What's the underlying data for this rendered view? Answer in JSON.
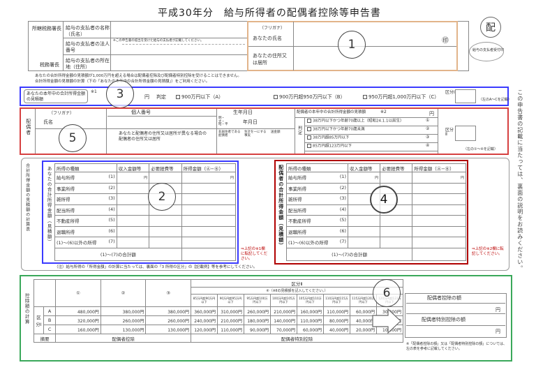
{
  "title": "平成30年分　給与所得者の配偶者控除等申告書",
  "stamp": "配",
  "stamp_sub": "給与の支払者受付印",
  "side_note": "この申告書の記載に当たっては、裏面の説明をお読みください。",
  "header": {
    "office": "所轄税務署長",
    "tax_office": "税務署長",
    "payer_name": "給与の支払者の名称（氏名）",
    "payer_number": "給与の支払者の法人番号",
    "number_note": "※この申告書の提出を受けた給与の支払者が記載してください。",
    "payer_address": "給与の支払者の所在地（住所）",
    "furigana": "（フリガナ）",
    "your_name": "あなたの氏名",
    "seal": "㊞",
    "your_address": "あなたの住所又は居所"
  },
  "notes": [
    "あなたの合計所得金額の見積額が1,000万円を超える場合は配偶者控除及び配偶者特別控除を受けることはできません。",
    "合計所得金額の見積額の計算（下の「あなたの本年中の合計所得金額の見積額」）をご利用ください。"
  ],
  "sec3": {
    "label": "あなたの本年中の合計所得金額の見積額",
    "mark": "※1",
    "yen": "円",
    "judge": "判定",
    "options": [
      "900万円以下（A）",
      "900万円超950万円以下（B）",
      "950万円超1,000万円以下（C）"
    ],
    "kubun": "区分Ⅰ",
    "kubun_note": "（左のA〜Cを記載）"
  },
  "sec5": {
    "spouse": "配偶者",
    "furigana": "（フリガナ）",
    "name": "氏名",
    "mynumber": "個人番号",
    "birth": "生年月日",
    "era": "明・大・昭・平",
    "ymd": "年月日",
    "diff_addr": "あなたと配偶者の住所又は居所が異なる場合の配偶者の住所又は居所",
    "col1": "非居住者である配偶者",
    "col2": "生計を一にする事実",
    "col3": "送金額",
    "income_hdr": "配偶者の本年中の合計所得金額の見積額",
    "mark": "※2",
    "yen": "円",
    "judge": "判定",
    "conds": [
      "38万円以下かつ年齢70歳以上（昭和24.1.1以前生）",
      "38万円以下かつ年齢70歳未満",
      "38万円超85万円以下",
      "85万円超123万円以下"
    ],
    "cond_nums": [
      "①",
      "②",
      "③",
      "④"
    ],
    "kubun": "区分Ⅱ",
    "kubun_note": "（左の①〜④を記載）"
  },
  "sec2": {
    "vlabel": "あなたの合計所得金額（見積額）",
    "headers": [
      "所得の種類",
      "収入金額等",
      "必要経費等",
      "所得金額（Ⓐ−Ⓑ）"
    ],
    "rows": [
      "給与所得",
      "事業所得",
      "雑所得",
      "配当所得",
      "不動産所得",
      "退職所得",
      "(1)〜(6)以外の所得"
    ],
    "nums": [
      "(1)",
      "(2)",
      "(3)",
      "(4)",
      "(5)",
      "(6)",
      "(7)"
    ],
    "total": "(1)〜(7)の合計額",
    "arrow_note": "⇒上記の※1欄に転記してください。",
    "yen": "円"
  },
  "sec4": {
    "vlabel": "配偶者の合計所得金額（見積額）",
    "headers": [
      "所得の種類",
      "収入金額等",
      "必要経費等",
      "所得金額（Ⓐ−Ⓑ）"
    ],
    "rows": [
      "給与所得",
      "事業所得",
      "雑所得",
      "配当所得",
      "不動産所得",
      "退職所得",
      "(1)〜(6)以外の所得"
    ],
    "nums": [
      "(1)",
      "(2)",
      "(3)",
      "(4)",
      "(5)",
      "(6)",
      "(7)"
    ],
    "total": "(1)〜(7)の合計額",
    "arrow_note": "⇒上記の※2欄に転記してください。",
    "yen": "円"
  },
  "calc_side": "合計所得金額の見積額の計算表",
  "footnote": "（注）給与所得の「所得金額」の計算に当たっては、裏面の「3 所得の区分」の【記載例】等を参考にしてください。",
  "sec6": {
    "side": "控除額の計算",
    "kubun2": "区分Ⅱ",
    "kubun1": "区分Ⅰ",
    "note": "④（※Ⅱの見積額を記入してください。）",
    "cols": [
      "①",
      "②",
      "③"
    ],
    "subcols": [
      "85万円超90万円以下",
      "90万円超95万円以下",
      "95万円超100万円以下",
      "100万円超105万円以下",
      "105万円超110万円以下",
      "110万円超115万円以下",
      "115万円超120万円以下",
      "120万円超123万円以下"
    ],
    "rows": [
      {
        "k": "A",
        "v": [
          "480,000円",
          "380,000円",
          "380,000円",
          "360,000円",
          "310,000円",
          "260,000円",
          "210,000円",
          "160,000円",
          "110,000円",
          "60,000円",
          "30,000円"
        ]
      },
      {
        "k": "B",
        "v": [
          "320,000円",
          "260,000円",
          "260,000円",
          "240,000円",
          "210,000円",
          "180,000円",
          "140,000円",
          "110,000円",
          "80,000円",
          "40,000円",
          "20,000円"
        ]
      },
      {
        "k": "C",
        "v": [
          "160,000円",
          "130,000円",
          "130,000円",
          "120,000円",
          "110,000円",
          "90,000円",
          "70,000円",
          "60,000円",
          "40,000円",
          "20,000円",
          "10,000円"
        ]
      }
    ],
    "summary": "摘要",
    "sp_ded": "配偶者控除",
    "sp_special": "配偶者特別控除",
    "out1": "配偶者控除の額",
    "out2": "配偶者特別控除の額",
    "yen": "円",
    "foot": "※「配偶者控除の額」又は「配偶者特別控除の額」については、左の表を参考に記載してください。"
  },
  "markers": [
    "1",
    "2",
    "3",
    "4",
    "5",
    "6"
  ],
  "colors": {
    "orange": "#e2b48a",
    "blue": "#3a3aff",
    "red": "#d64040",
    "darkred": "#b00000",
    "green": "#3aa85a"
  }
}
